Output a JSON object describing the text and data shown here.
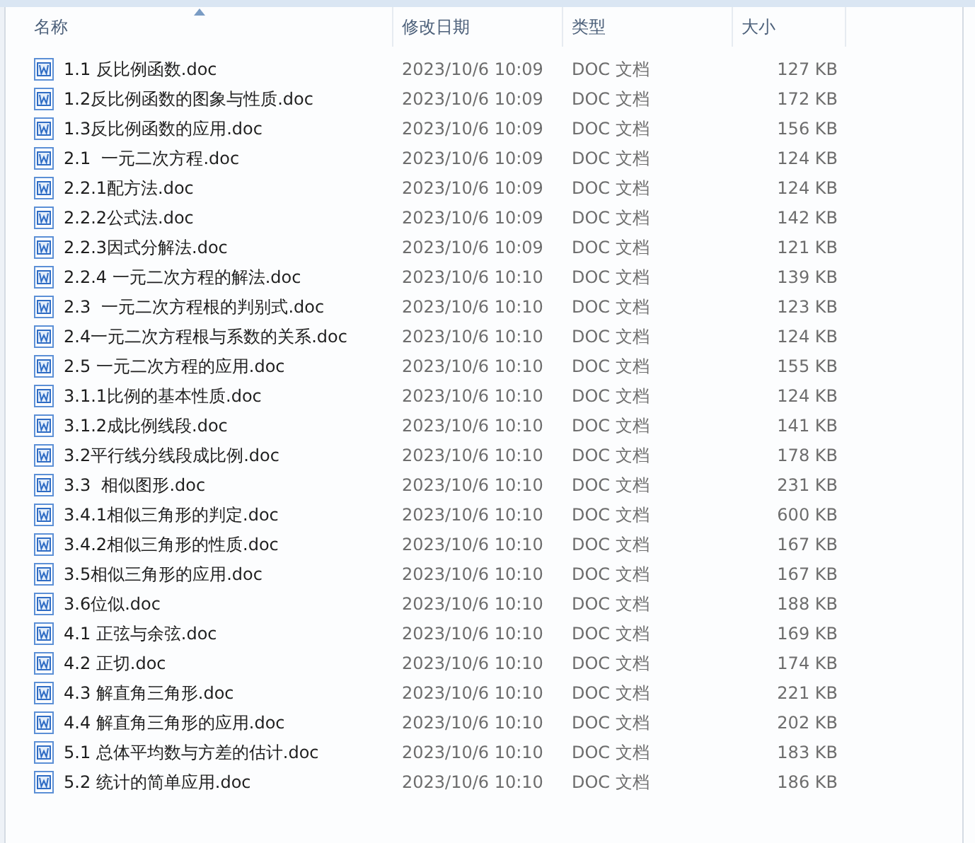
{
  "columns": [
    {
      "label": "名称",
      "sorted": true
    },
    {
      "label": "修改日期",
      "sorted": false
    },
    {
      "label": "类型",
      "sorted": false
    },
    {
      "label": "大小",
      "sorted": false
    }
  ],
  "files": [
    {
      "name": "1.1 反比例函数.doc",
      "modified": "2023/10/6 10:09",
      "type": "DOC 文档",
      "size": "127 KB"
    },
    {
      "name": "1.2反比例函数的图象与性质.doc",
      "modified": "2023/10/6 10:09",
      "type": "DOC 文档",
      "size": "172 KB"
    },
    {
      "name": "1.3反比例函数的应用.doc",
      "modified": "2023/10/6 10:09",
      "type": "DOC 文档",
      "size": "156 KB"
    },
    {
      "name": "2.1  一元二次方程.doc",
      "modified": "2023/10/6 10:09",
      "type": "DOC 文档",
      "size": "124 KB"
    },
    {
      "name": "2.2.1配方法.doc",
      "modified": "2023/10/6 10:09",
      "type": "DOC 文档",
      "size": "124 KB"
    },
    {
      "name": "2.2.2公式法.doc",
      "modified": "2023/10/6 10:09",
      "type": "DOC 文档",
      "size": "142 KB"
    },
    {
      "name": "2.2.3因式分解法.doc",
      "modified": "2023/10/6 10:09",
      "type": "DOC 文档",
      "size": "121 KB"
    },
    {
      "name": "2.2.4 一元二次方程的解法.doc",
      "modified": "2023/10/6 10:10",
      "type": "DOC 文档",
      "size": "139 KB"
    },
    {
      "name": "2.3  一元二次方程根的判别式.doc",
      "modified": "2023/10/6 10:10",
      "type": "DOC 文档",
      "size": "123 KB"
    },
    {
      "name": "2.4一元二次方程根与系数的关系.doc",
      "modified": "2023/10/6 10:10",
      "type": "DOC 文档",
      "size": "124 KB"
    },
    {
      "name": "2.5 一元二次方程的应用.doc",
      "modified": "2023/10/6 10:10",
      "type": "DOC 文档",
      "size": "155 KB"
    },
    {
      "name": "3.1.1比例的基本性质.doc",
      "modified": "2023/10/6 10:10",
      "type": "DOC 文档",
      "size": "124 KB"
    },
    {
      "name": "3.1.2成比例线段.doc",
      "modified": "2023/10/6 10:10",
      "type": "DOC 文档",
      "size": "141 KB"
    },
    {
      "name": "3.2平行线分线段成比例.doc",
      "modified": "2023/10/6 10:10",
      "type": "DOC 文档",
      "size": "178 KB"
    },
    {
      "name": "3.3  相似图形.doc",
      "modified": "2023/10/6 10:10",
      "type": "DOC 文档",
      "size": "231 KB"
    },
    {
      "name": "3.4.1相似三角形的判定.doc",
      "modified": "2023/10/6 10:10",
      "type": "DOC 文档",
      "size": "600 KB"
    },
    {
      "name": "3.4.2相似三角形的性质.doc",
      "modified": "2023/10/6 10:10",
      "type": "DOC 文档",
      "size": "167 KB"
    },
    {
      "name": "3.5相似三角形的应用.doc",
      "modified": "2023/10/6 10:10",
      "type": "DOC 文档",
      "size": "167 KB"
    },
    {
      "name": "3.6位似.doc",
      "modified": "2023/10/6 10:10",
      "type": "DOC 文档",
      "size": "188 KB"
    },
    {
      "name": "4.1 正弦与余弦.doc",
      "modified": "2023/10/6 10:10",
      "type": "DOC 文档",
      "size": "169 KB"
    },
    {
      "name": "4.2 正切.doc",
      "modified": "2023/10/6 10:10",
      "type": "DOC 文档",
      "size": "174 KB"
    },
    {
      "name": "4.3 解直角三角形.doc",
      "modified": "2023/10/6 10:10",
      "type": "DOC 文档",
      "size": "221 KB"
    },
    {
      "name": "4.4 解直角三角形的应用.doc",
      "modified": "2023/10/6 10:10",
      "type": "DOC 文档",
      "size": "202 KB"
    },
    {
      "name": "5.1 总体平均数与方差的估计.doc",
      "modified": "2023/10/6 10:10",
      "type": "DOC 文档",
      "size": "183 KB"
    },
    {
      "name": "5.2 统计的简单应用.doc",
      "modified": "2023/10/6 10:10",
      "type": "DOC 文档",
      "size": "186 KB"
    }
  ]
}
